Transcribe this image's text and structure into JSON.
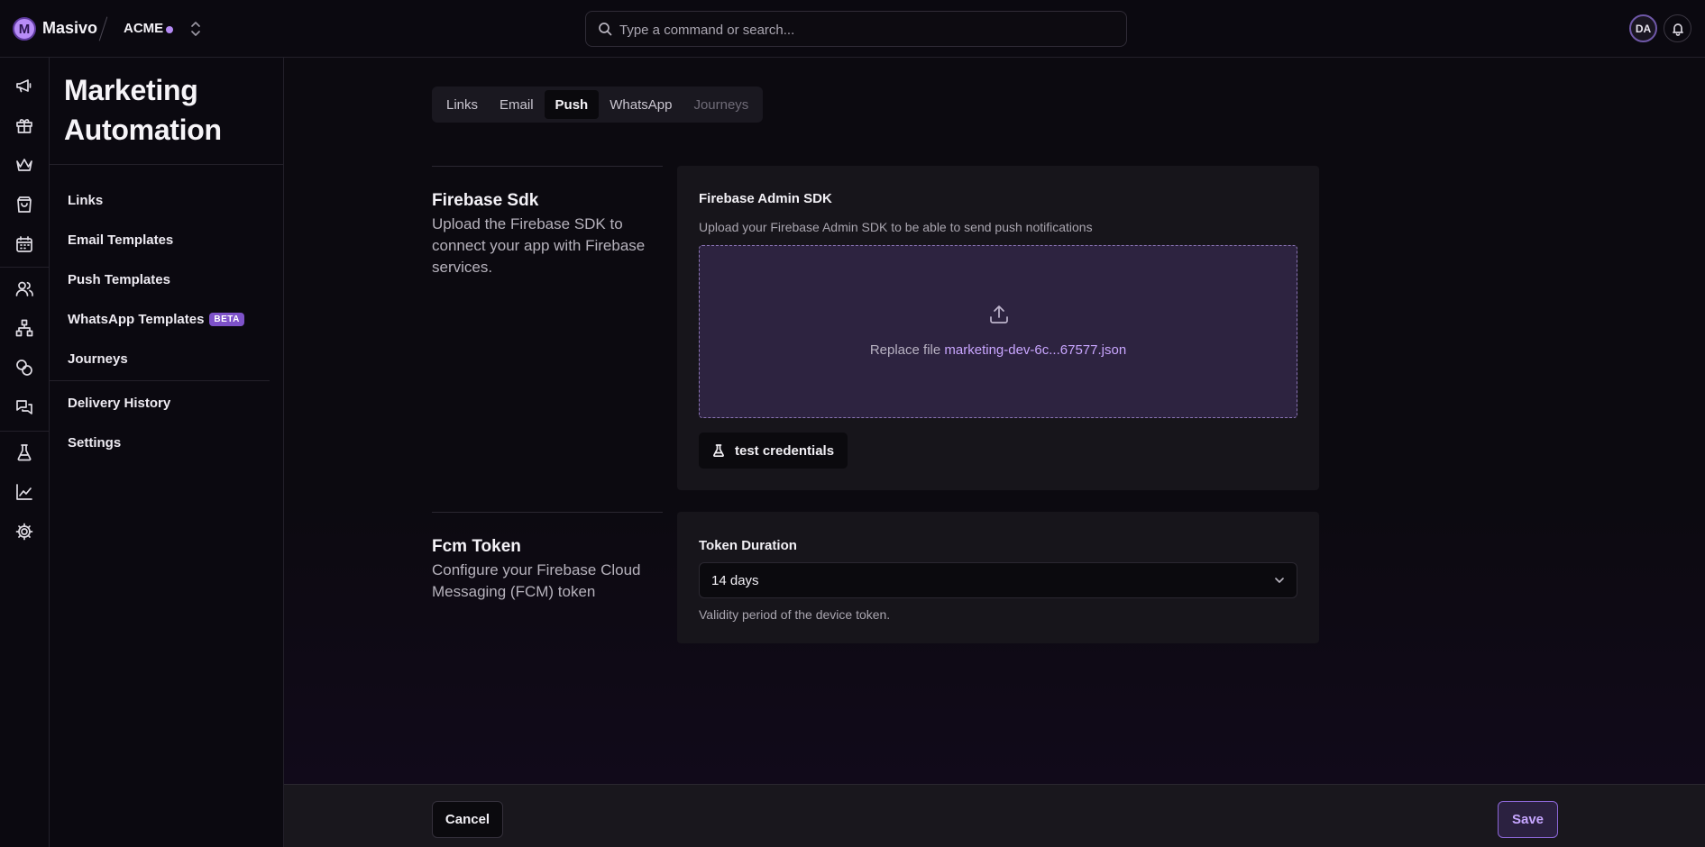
{
  "app": {
    "brand": "Masivo",
    "logo_letter": "M",
    "org": "ACME",
    "search_placeholder": "Type a command or search...",
    "user_initials": "DA"
  },
  "rail": {
    "icons": [
      "megaphone-icon",
      "gift-icon",
      "crown-icon",
      "shopping-bag-icon",
      "calendar-icon",
      "users-icon",
      "hierarchy-icon",
      "coins-icon",
      "chat-icon",
      "flask-icon",
      "chart-icon",
      "gear-icon"
    ]
  },
  "sidenav": {
    "title_line1": "Marketing",
    "title_line2": "Automation",
    "items": [
      {
        "label": "Links"
      },
      {
        "label": "Email Templates"
      },
      {
        "label": "Push Templates"
      },
      {
        "label": "WhatsApp Templates",
        "badge": "BETA"
      },
      {
        "label": "Journeys"
      },
      {
        "label": "Delivery History"
      },
      {
        "label": "Settings"
      }
    ]
  },
  "tabs": [
    {
      "label": "Links"
    },
    {
      "label": "Email"
    },
    {
      "label": "Push"
    },
    {
      "label": "WhatsApp"
    },
    {
      "label": "Journeys"
    }
  ],
  "active_tab": "Push",
  "firebase": {
    "title": "Firebase Sdk",
    "description": "Upload the Firebase SDK to connect your app with Firebase services.",
    "card_label": "Firebase Admin SDK",
    "card_help": "Upload your Firebase Admin SDK to be able to send push notifications",
    "replace_text": "Replace file",
    "file_name": "marketing-dev-6c...67577.json",
    "test_button": "test credentials"
  },
  "fcm": {
    "title": "Fcm Token",
    "description": "Configure your Firebase Cloud Messaging (FCM) token",
    "field_label": "Token Duration",
    "selected_value": "14 days",
    "help": "Validity period of the device token."
  },
  "footer": {
    "cancel_label": "Cancel",
    "save_label": "Save"
  },
  "colors": {
    "accent": "#b48af5",
    "background": "#0b0910",
    "card": "#17151b",
    "dropzone": "#2d2340"
  }
}
